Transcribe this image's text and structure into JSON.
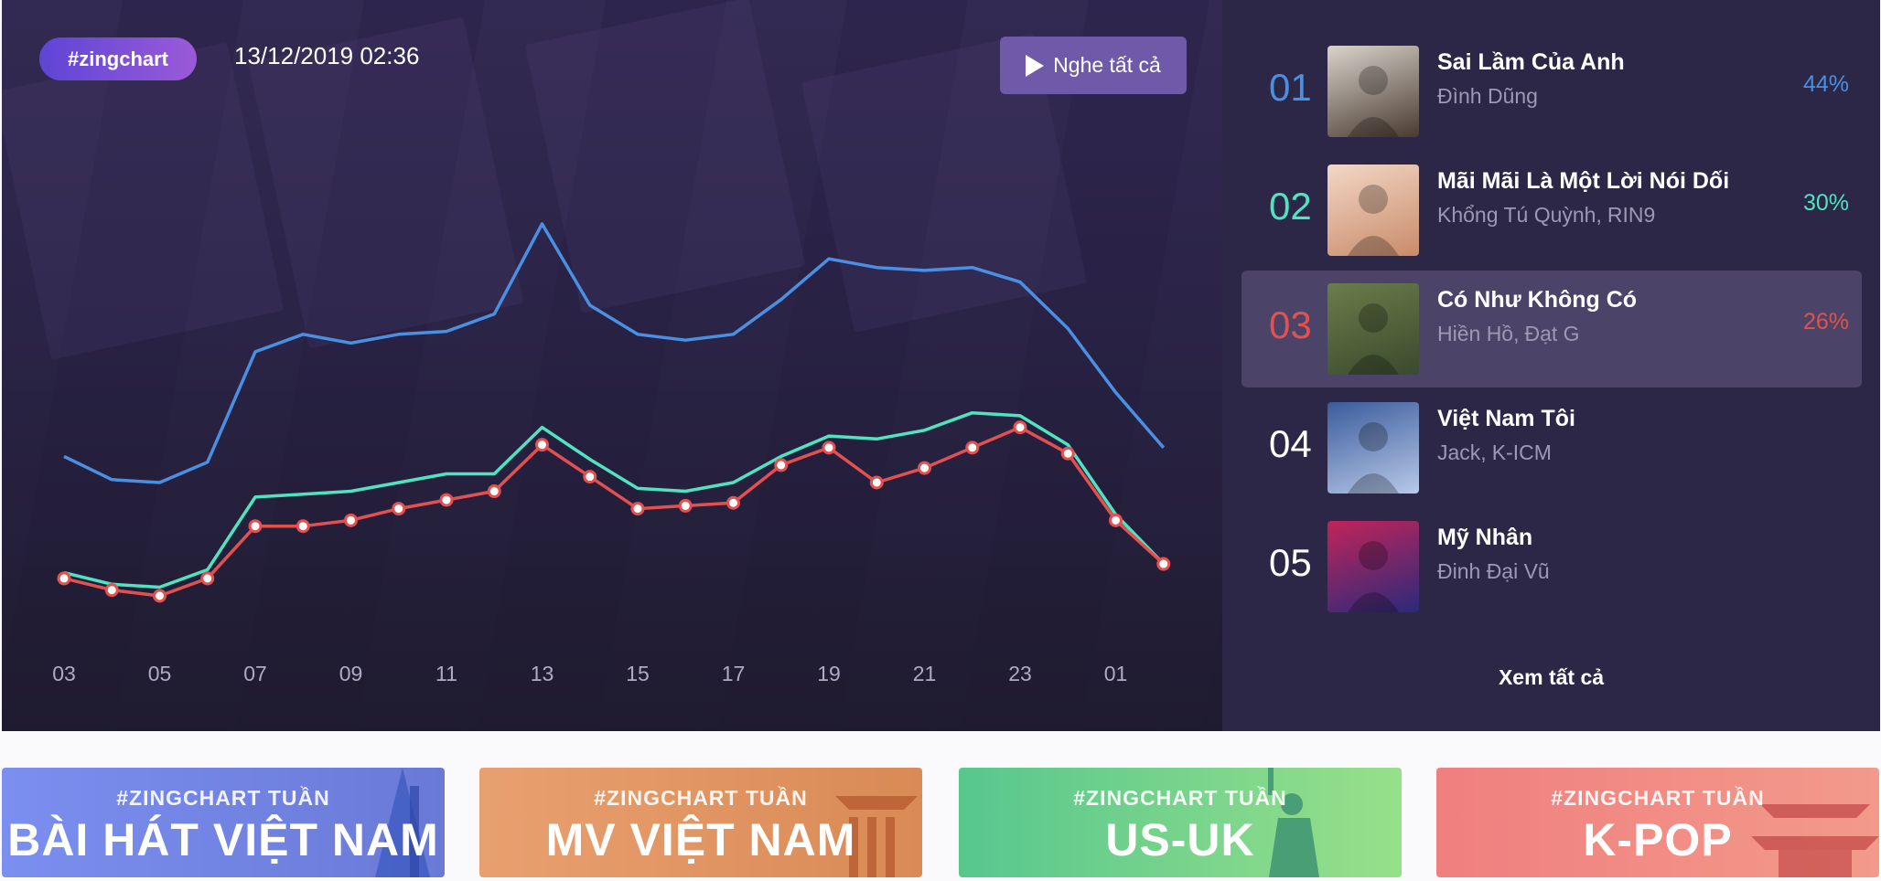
{
  "header": {
    "tag": "#zingchart",
    "datetime": "13/12/2019 02:36",
    "play_all_label": "Nghe tất cả"
  },
  "chart_data": {
    "type": "line",
    "x": [
      "03",
      "04",
      "05",
      "06",
      "07",
      "08",
      "09",
      "10",
      "11",
      "12",
      "13",
      "14",
      "15",
      "16",
      "17",
      "18",
      "19",
      "20",
      "21",
      "22",
      "23",
      "00",
      "01",
      "02"
    ],
    "x_tick_labels": [
      "03",
      "05",
      "07",
      "09",
      "11",
      "13",
      "15",
      "17",
      "19",
      "21",
      "23",
      "01"
    ],
    "series": [
      {
        "color": "#4a90e2",
        "values": [
          44,
          40,
          39.5,
          43,
          62,
          65,
          63.5,
          65,
          65.5,
          68.5,
          84,
          70,
          65,
          64,
          65,
          71,
          78,
          76.5,
          76,
          76.5,
          74,
          66,
          55,
          45.5
        ]
      },
      {
        "color": "#50e3c2",
        "values": [
          24,
          22,
          21.5,
          24.5,
          37,
          37.5,
          38,
          39.5,
          41,
          41,
          49,
          43.5,
          38.5,
          38,
          39.5,
          44,
          47.5,
          47,
          48.5,
          51.5,
          51,
          46,
          34,
          25.5
        ]
      },
      {
        "color": "#e35050",
        "values": [
          23,
          21,
          20,
          23,
          32,
          32,
          33,
          35,
          36.5,
          38,
          46,
          40.5,
          35,
          35.5,
          36,
          42.5,
          45.5,
          39.5,
          42,
          45.5,
          49,
          44.5,
          33,
          25.5
        ]
      }
    ],
    "grid": false,
    "legend": "none"
  },
  "ranking": {
    "items": [
      {
        "rank": "01",
        "title": "Sai Lầm Của Anh",
        "artists": [
          "Đình Dũng"
        ],
        "percent": "44%",
        "color": "#4a90e2"
      },
      {
        "rank": "02",
        "title": "Mãi Mãi Là Một Lời Nói Dối",
        "artists": [
          "Khổng Tú Quỳnh,",
          "RIN9"
        ],
        "percent": "30%",
        "color": "#50e3c2"
      },
      {
        "rank": "03",
        "title": "Có Như Không Có",
        "artists": [
          "Hiền Hồ,",
          "Đạt G"
        ],
        "percent": "26%",
        "color": "#e35050"
      },
      {
        "rank": "04",
        "title": "Việt Nam Tôi",
        "artists": [
          "Jack,",
          "K-ICM"
        ],
        "percent": "",
        "color": "#ffffff"
      },
      {
        "rank": "05",
        "title": "Mỹ Nhân",
        "artists": [
          "Đinh Đại Vũ"
        ],
        "percent": "",
        "color": "#ffffff"
      }
    ],
    "view_all_label": "Xem tất cả"
  },
  "banners": [
    {
      "small": "#ZINGCHART TUẦN",
      "big": "BÀI HÁT VIỆT NAM"
    },
    {
      "small": "#ZINGCHART TUẦN",
      "big": "MV VIỆT NAM"
    },
    {
      "small": "#ZINGCHART TUẦN",
      "big": "US-UK"
    },
    {
      "small": "#ZINGCHART TUẦN",
      "big": "K-POP"
    }
  ]
}
